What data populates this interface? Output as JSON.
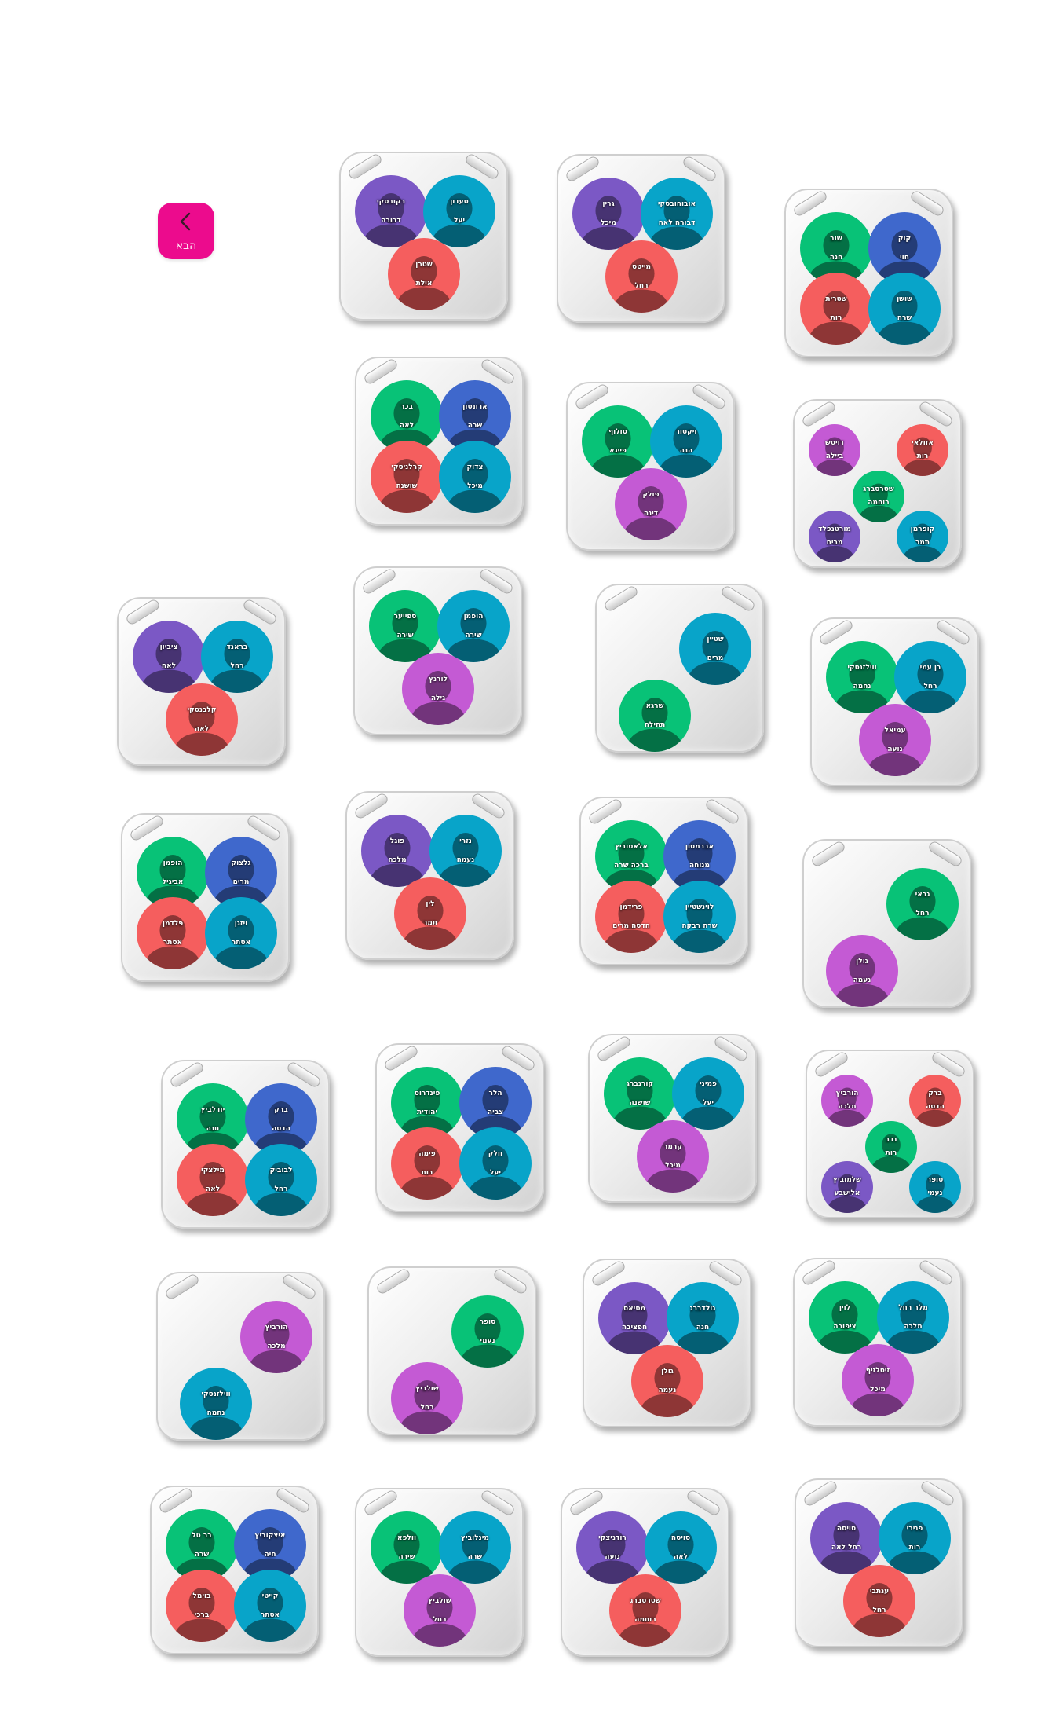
{
  "colors": {
    "green": "#08c277",
    "blue": "#3f68cc",
    "teal": "#08a4c9",
    "red": "#f55e5e",
    "purple": "#7b58c5",
    "magenta": "#c45ad4",
    "accent": "#ec0b8d"
  },
  "next_button": {
    "label": "הבא",
    "icon": "chevron-left-icon"
  },
  "tables": [
    {
      "seats": [
        {
          "last": "רקובסקי",
          "first": "דבורה",
          "color": "purple"
        },
        {
          "last": "סעדון",
          "first": "יעל",
          "color": "teal"
        },
        {
          "last": "שטרן",
          "first": "אילת",
          "color": "red"
        }
      ]
    },
    {
      "seats": [
        {
          "last": "גרין",
          "first": "מיכל",
          "color": "purple"
        },
        {
          "last": "אובוחובסקי",
          "first": "דבורה לאה",
          "color": "teal"
        },
        {
          "last": "מייטס",
          "first": "רחל",
          "color": "red"
        }
      ]
    },
    {
      "seats": [
        {
          "last": "שוב",
          "first": "חנה",
          "color": "green"
        },
        {
          "last": "קוק",
          "first": "חוי",
          "color": "blue"
        },
        {
          "last": "שטרית",
          "first": "רות",
          "color": "red"
        },
        {
          "last": "שושן",
          "first": "שרה",
          "color": "teal"
        }
      ]
    },
    {
      "seats": [
        {
          "last": "בכר",
          "first": "לאה",
          "color": "green"
        },
        {
          "last": "ארונסון",
          "first": "שרה",
          "color": "blue"
        },
        {
          "last": "קרלניסקי",
          "first": "שושנה",
          "color": "red"
        },
        {
          "last": "צדוק",
          "first": "מיכל",
          "color": "teal"
        }
      ]
    },
    {
      "seats": [
        {
          "last": "סולוף",
          "first": "פייגא",
          "color": "green"
        },
        {
          "last": "ויקטור",
          "first": "הנה",
          "color": "teal"
        },
        {
          "last": "פולק",
          "first": "דינה",
          "color": "magenta"
        }
      ]
    },
    {
      "seats": [
        {
          "last": "דויטש",
          "first": "ביילה",
          "color": "magenta"
        },
        {
          "last": "אזולאי",
          "first": "רות",
          "color": "red"
        },
        {
          "last": "שטרסברג",
          "first": "רוחמה",
          "color": "green"
        },
        {
          "last": "מורטנפלד",
          "first": "מרים",
          "color": "purple"
        },
        {
          "last": "קופרמן",
          "first": "תמר",
          "color": "teal"
        }
      ]
    },
    {
      "seats": [
        {
          "last": "ציביון",
          "first": "לאה",
          "color": "purple"
        },
        {
          "last": "בראנד",
          "first": "רחל",
          "color": "teal"
        },
        {
          "last": "קלבנסקי",
          "first": "לאה",
          "color": "red"
        }
      ]
    },
    {
      "seats": [
        {
          "last": "ספייער",
          "first": "שירה",
          "color": "green"
        },
        {
          "last": "הופמן",
          "first": "שירה",
          "color": "teal"
        },
        {
          "last": "לורנץ",
          "first": "גילה",
          "color": "magenta"
        }
      ]
    },
    {
      "seats": [
        {
          "last": "שטיין",
          "first": "מרים",
          "color": "teal"
        },
        {
          "last": "שרגא",
          "first": "תהילה",
          "color": "green"
        }
      ]
    },
    {
      "seats": [
        {
          "last": "ווילזנסקי",
          "first": "נחמה",
          "color": "green"
        },
        {
          "last": "בן עמי",
          "first": "רחל",
          "color": "teal"
        },
        {
          "last": "עמיאל",
          "first": "נועה",
          "color": "magenta"
        }
      ]
    },
    {
      "seats": [
        {
          "last": "הופמן",
          "first": "אביגיל",
          "color": "green"
        },
        {
          "last": "גלצוק",
          "first": "מרים",
          "color": "blue"
        },
        {
          "last": "פלדמן",
          "first": "אסתר",
          "color": "red"
        },
        {
          "last": "ויזגן",
          "first": "אסתר",
          "color": "teal"
        }
      ]
    },
    {
      "seats": [
        {
          "last": "פוגל",
          "first": "מלכה",
          "color": "purple"
        },
        {
          "last": "נזרי",
          "first": "נעמה",
          "color": "teal"
        },
        {
          "last": "לין",
          "first": "תמר",
          "color": "red"
        }
      ]
    },
    {
      "seats": [
        {
          "last": "אלאטוביץ",
          "first": "ברכה שרה",
          "color": "green"
        },
        {
          "last": "אברמסון",
          "first": "מנוחה",
          "color": "blue"
        },
        {
          "last": "פרידמן",
          "first": "הדסה מרים",
          "color": "red"
        },
        {
          "last": "לוינשטיין",
          "first": "שרה רבקה",
          "color": "teal"
        }
      ]
    },
    {
      "seats": [
        {
          "last": "גבאי",
          "first": "רחל",
          "color": "green"
        },
        {
          "last": "גולן",
          "first": "נעמה",
          "color": "magenta"
        }
      ]
    },
    {
      "seats": [
        {
          "last": "יודלביץ",
          "first": "חנה",
          "color": "green"
        },
        {
          "last": "ברק",
          "first": "הדסה",
          "color": "blue"
        },
        {
          "last": "מילצקי",
          "first": "לאה",
          "color": "red"
        },
        {
          "last": "לבוביק",
          "first": "רחל",
          "color": "teal"
        }
      ]
    },
    {
      "seats": [
        {
          "last": "פינדרוס",
          "first": "יהודית",
          "color": "green"
        },
        {
          "last": "הלר",
          "first": "צביה",
          "color": "blue"
        },
        {
          "last": "פימה",
          "first": "רות",
          "color": "red"
        },
        {
          "last": "וולק",
          "first": "יעל",
          "color": "teal"
        }
      ]
    },
    {
      "seats": [
        {
          "last": "קורנברג",
          "first": "שושנה",
          "color": "green"
        },
        {
          "last": "פמיני",
          "first": "יעל",
          "color": "teal"
        },
        {
          "last": "קרמר",
          "first": "מיכל",
          "color": "magenta"
        }
      ]
    },
    {
      "seats": [
        {
          "last": "הורביץ",
          "first": "מלכה",
          "color": "magenta"
        },
        {
          "last": "ברק",
          "first": "הדסה",
          "color": "red"
        },
        {
          "last": "נדב",
          "first": "רות",
          "color": "green"
        },
        {
          "last": "שלמוביץ",
          "first": "אלישבע",
          "color": "purple"
        },
        {
          "last": "סופר",
          "first": "נעמי",
          "color": "teal"
        }
      ]
    },
    {
      "seats": [
        {
          "last": "הורביץ",
          "first": "מלכה",
          "color": "magenta"
        },
        {
          "last": "ווילזנסקי",
          "first": "נחמה",
          "color": "teal"
        }
      ]
    },
    {
      "seats": [
        {
          "last": "סופר",
          "first": "נעמי",
          "color": "green"
        },
        {
          "last": "שולביץ",
          "first": "רחל",
          "color": "magenta"
        }
      ]
    },
    {
      "seats": [
        {
          "last": "מסיאס",
          "first": "חפציבה",
          "color": "purple"
        },
        {
          "last": "גולדברג",
          "first": "חנה",
          "color": "teal"
        },
        {
          "last": "גולן",
          "first": "נעמה",
          "color": "red"
        }
      ]
    },
    {
      "seats": [
        {
          "last": "לוין",
          "first": "ציפורה",
          "color": "green"
        },
        {
          "last": "מלר רחל",
          "first": "מלכה",
          "color": "teal"
        },
        {
          "last": "זיטלזיף",
          "first": "מיכל",
          "color": "magenta"
        }
      ]
    },
    {
      "seats": [
        {
          "last": "בר טל",
          "first": "שרה",
          "color": "green"
        },
        {
          "last": "איצקוביץ",
          "first": "חיה",
          "color": "blue"
        },
        {
          "last": "בוימל",
          "first": "ברכי",
          "color": "red"
        },
        {
          "last": "קייטי",
          "first": "אסתר",
          "color": "teal"
        }
      ]
    },
    {
      "seats": [
        {
          "last": "וולפא",
          "first": "שירה",
          "color": "green"
        },
        {
          "last": "מינלוביץ",
          "first": "שרה",
          "color": "teal"
        },
        {
          "last": "שולביץ",
          "first": "רחל",
          "color": "magenta"
        }
      ]
    },
    {
      "seats": [
        {
          "last": "רודניצקי",
          "first": "נועה",
          "color": "purple"
        },
        {
          "last": "סויסה",
          "first": "לאה",
          "color": "teal"
        },
        {
          "last": "שטרסברג",
          "first": "רוחמה",
          "color": "red"
        }
      ]
    },
    {
      "seats": [
        {
          "last": "סויסה",
          "first": "רחל לאה",
          "color": "purple"
        },
        {
          "last": "פנירי",
          "first": "רות",
          "color": "teal"
        },
        {
          "last": "ענתבי",
          "first": "רחל",
          "color": "red"
        }
      ]
    }
  ]
}
